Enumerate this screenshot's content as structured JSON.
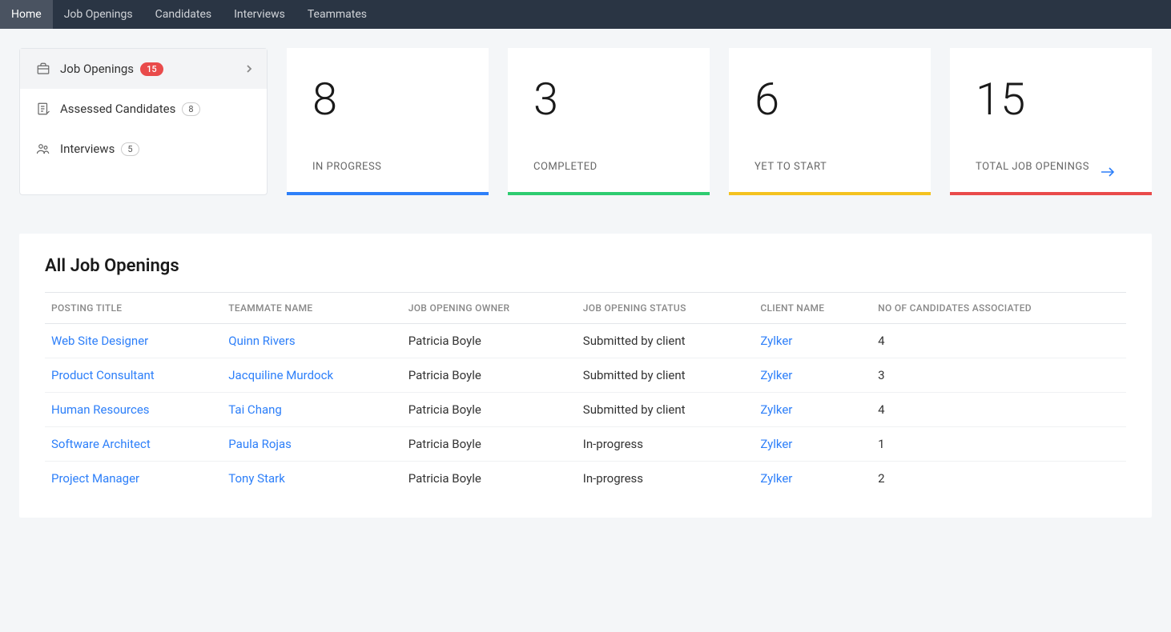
{
  "nav": {
    "items": [
      "Home",
      "Job Openings",
      "Candidates",
      "Interviews",
      "Teammates"
    ],
    "activeIndex": 0
  },
  "sidebar": {
    "items": [
      {
        "label": "Job Openings",
        "badge": "15",
        "badgeStyle": "red",
        "hasChevron": true,
        "icon": "briefcase",
        "active": true
      },
      {
        "label": "Assessed Candidates",
        "badge": "8",
        "badgeStyle": "gray",
        "hasChevron": false,
        "icon": "checklist",
        "active": false
      },
      {
        "label": "Interviews",
        "badge": "5",
        "badgeStyle": "gray",
        "hasChevron": false,
        "icon": "people",
        "active": false
      }
    ]
  },
  "stats": [
    {
      "value": "8",
      "label": "IN PROGRESS",
      "bar": "blue",
      "arrow": false
    },
    {
      "value": "3",
      "label": "COMPLETED",
      "bar": "green",
      "arrow": false
    },
    {
      "value": "6",
      "label": "YET TO START",
      "bar": "yellow",
      "arrow": false
    },
    {
      "value": "15",
      "label": "TOTAL JOB OPENINGS",
      "bar": "red",
      "arrow": true
    }
  ],
  "table": {
    "title": "All Job Openings",
    "headers": [
      "POSTING TITLE",
      "TEAMMATE NAME",
      "JOB OPENING OWNER",
      "JOB OPENING STATUS",
      "CLIENT NAME",
      "NO OF CANDIDATES ASSOCIATED"
    ],
    "rows": [
      {
        "title": "Web Site Designer",
        "teammate": "Quinn Rivers",
        "owner": "Patricia Boyle",
        "status": "Submitted by client",
        "client": "Zylker",
        "count": "4"
      },
      {
        "title": "Product Consultant",
        "teammate": "Jacquiline Murdock",
        "owner": "Patricia Boyle",
        "status": "Submitted by client",
        "client": "Zylker",
        "count": "3"
      },
      {
        "title": "Human Resources",
        "teammate": "Tai Chang",
        "owner": "Patricia Boyle",
        "status": "Submitted by client",
        "client": "Zylker",
        "count": "4"
      },
      {
        "title": "Software Architect",
        "teammate": "Paula Rojas",
        "owner": "Patricia Boyle",
        "status": "In-progress",
        "client": "Zylker",
        "count": "1"
      },
      {
        "title": "Project Manager",
        "teammate": "Tony Stark",
        "owner": "Patricia Boyle",
        "status": "In-progress",
        "client": "Zylker",
        "count": "2"
      }
    ]
  }
}
